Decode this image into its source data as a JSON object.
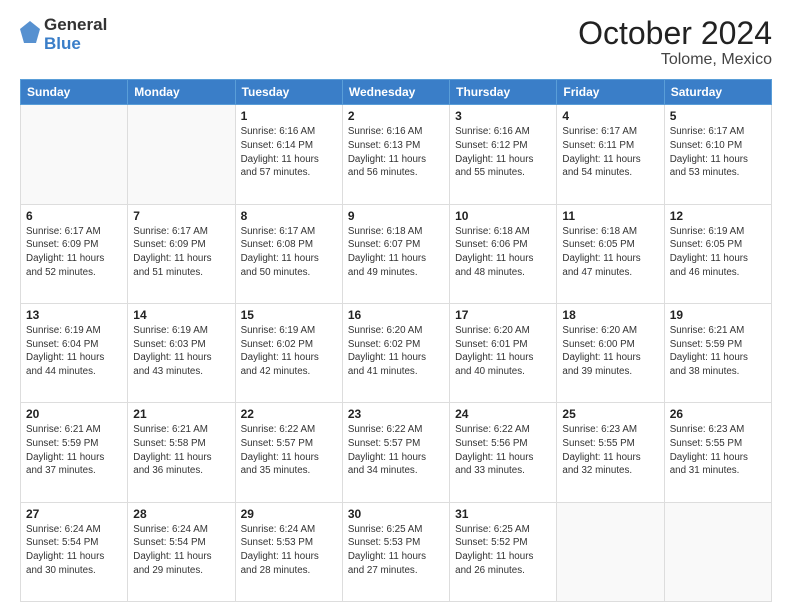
{
  "header": {
    "logo_general": "General",
    "logo_blue": "Blue",
    "month": "October 2024",
    "location": "Tolome, Mexico"
  },
  "weekdays": [
    "Sunday",
    "Monday",
    "Tuesday",
    "Wednesday",
    "Thursday",
    "Friday",
    "Saturday"
  ],
  "weeks": [
    [
      {
        "day": "",
        "sunrise": "",
        "sunset": "",
        "daylight": ""
      },
      {
        "day": "",
        "sunrise": "",
        "sunset": "",
        "daylight": ""
      },
      {
        "day": "1",
        "sunrise": "Sunrise: 6:16 AM",
        "sunset": "Sunset: 6:14 PM",
        "daylight": "Daylight: 11 hours and 57 minutes."
      },
      {
        "day": "2",
        "sunrise": "Sunrise: 6:16 AM",
        "sunset": "Sunset: 6:13 PM",
        "daylight": "Daylight: 11 hours and 56 minutes."
      },
      {
        "day": "3",
        "sunrise": "Sunrise: 6:16 AM",
        "sunset": "Sunset: 6:12 PM",
        "daylight": "Daylight: 11 hours and 55 minutes."
      },
      {
        "day": "4",
        "sunrise": "Sunrise: 6:17 AM",
        "sunset": "Sunset: 6:11 PM",
        "daylight": "Daylight: 11 hours and 54 minutes."
      },
      {
        "day": "5",
        "sunrise": "Sunrise: 6:17 AM",
        "sunset": "Sunset: 6:10 PM",
        "daylight": "Daylight: 11 hours and 53 minutes."
      }
    ],
    [
      {
        "day": "6",
        "sunrise": "Sunrise: 6:17 AM",
        "sunset": "Sunset: 6:09 PM",
        "daylight": "Daylight: 11 hours and 52 minutes."
      },
      {
        "day": "7",
        "sunrise": "Sunrise: 6:17 AM",
        "sunset": "Sunset: 6:09 PM",
        "daylight": "Daylight: 11 hours and 51 minutes."
      },
      {
        "day": "8",
        "sunrise": "Sunrise: 6:17 AM",
        "sunset": "Sunset: 6:08 PM",
        "daylight": "Daylight: 11 hours and 50 minutes."
      },
      {
        "day": "9",
        "sunrise": "Sunrise: 6:18 AM",
        "sunset": "Sunset: 6:07 PM",
        "daylight": "Daylight: 11 hours and 49 minutes."
      },
      {
        "day": "10",
        "sunrise": "Sunrise: 6:18 AM",
        "sunset": "Sunset: 6:06 PM",
        "daylight": "Daylight: 11 hours and 48 minutes."
      },
      {
        "day": "11",
        "sunrise": "Sunrise: 6:18 AM",
        "sunset": "Sunset: 6:05 PM",
        "daylight": "Daylight: 11 hours and 47 minutes."
      },
      {
        "day": "12",
        "sunrise": "Sunrise: 6:19 AM",
        "sunset": "Sunset: 6:05 PM",
        "daylight": "Daylight: 11 hours and 46 minutes."
      }
    ],
    [
      {
        "day": "13",
        "sunrise": "Sunrise: 6:19 AM",
        "sunset": "Sunset: 6:04 PM",
        "daylight": "Daylight: 11 hours and 44 minutes."
      },
      {
        "day": "14",
        "sunrise": "Sunrise: 6:19 AM",
        "sunset": "Sunset: 6:03 PM",
        "daylight": "Daylight: 11 hours and 43 minutes."
      },
      {
        "day": "15",
        "sunrise": "Sunrise: 6:19 AM",
        "sunset": "Sunset: 6:02 PM",
        "daylight": "Daylight: 11 hours and 42 minutes."
      },
      {
        "day": "16",
        "sunrise": "Sunrise: 6:20 AM",
        "sunset": "Sunset: 6:02 PM",
        "daylight": "Daylight: 11 hours and 41 minutes."
      },
      {
        "day": "17",
        "sunrise": "Sunrise: 6:20 AM",
        "sunset": "Sunset: 6:01 PM",
        "daylight": "Daylight: 11 hours and 40 minutes."
      },
      {
        "day": "18",
        "sunrise": "Sunrise: 6:20 AM",
        "sunset": "Sunset: 6:00 PM",
        "daylight": "Daylight: 11 hours and 39 minutes."
      },
      {
        "day": "19",
        "sunrise": "Sunrise: 6:21 AM",
        "sunset": "Sunset: 5:59 PM",
        "daylight": "Daylight: 11 hours and 38 minutes."
      }
    ],
    [
      {
        "day": "20",
        "sunrise": "Sunrise: 6:21 AM",
        "sunset": "Sunset: 5:59 PM",
        "daylight": "Daylight: 11 hours and 37 minutes."
      },
      {
        "day": "21",
        "sunrise": "Sunrise: 6:21 AM",
        "sunset": "Sunset: 5:58 PM",
        "daylight": "Daylight: 11 hours and 36 minutes."
      },
      {
        "day": "22",
        "sunrise": "Sunrise: 6:22 AM",
        "sunset": "Sunset: 5:57 PM",
        "daylight": "Daylight: 11 hours and 35 minutes."
      },
      {
        "day": "23",
        "sunrise": "Sunrise: 6:22 AM",
        "sunset": "Sunset: 5:57 PM",
        "daylight": "Daylight: 11 hours and 34 minutes."
      },
      {
        "day": "24",
        "sunrise": "Sunrise: 6:22 AM",
        "sunset": "Sunset: 5:56 PM",
        "daylight": "Daylight: 11 hours and 33 minutes."
      },
      {
        "day": "25",
        "sunrise": "Sunrise: 6:23 AM",
        "sunset": "Sunset: 5:55 PM",
        "daylight": "Daylight: 11 hours and 32 minutes."
      },
      {
        "day": "26",
        "sunrise": "Sunrise: 6:23 AM",
        "sunset": "Sunset: 5:55 PM",
        "daylight": "Daylight: 11 hours and 31 minutes."
      }
    ],
    [
      {
        "day": "27",
        "sunrise": "Sunrise: 6:24 AM",
        "sunset": "Sunset: 5:54 PM",
        "daylight": "Daylight: 11 hours and 30 minutes."
      },
      {
        "day": "28",
        "sunrise": "Sunrise: 6:24 AM",
        "sunset": "Sunset: 5:54 PM",
        "daylight": "Daylight: 11 hours and 29 minutes."
      },
      {
        "day": "29",
        "sunrise": "Sunrise: 6:24 AM",
        "sunset": "Sunset: 5:53 PM",
        "daylight": "Daylight: 11 hours and 28 minutes."
      },
      {
        "day": "30",
        "sunrise": "Sunrise: 6:25 AM",
        "sunset": "Sunset: 5:53 PM",
        "daylight": "Daylight: 11 hours and 27 minutes."
      },
      {
        "day": "31",
        "sunrise": "Sunrise: 6:25 AM",
        "sunset": "Sunset: 5:52 PM",
        "daylight": "Daylight: 11 hours and 26 minutes."
      },
      {
        "day": "",
        "sunrise": "",
        "sunset": "",
        "daylight": ""
      },
      {
        "day": "",
        "sunrise": "",
        "sunset": "",
        "daylight": ""
      }
    ]
  ]
}
